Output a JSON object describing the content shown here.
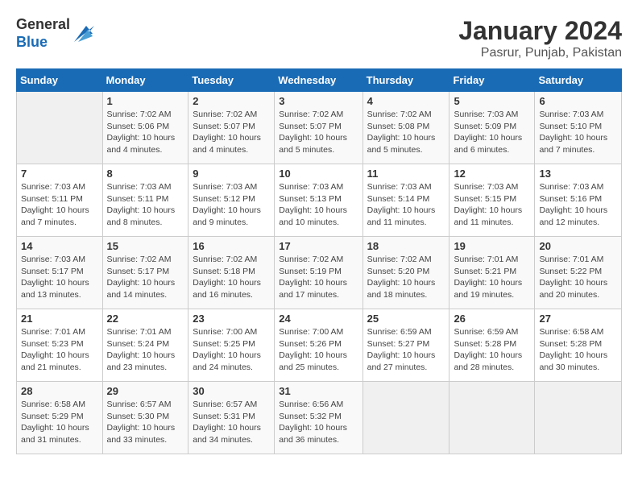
{
  "header": {
    "logo_line1": "General",
    "logo_line2": "Blue",
    "title": "January 2024",
    "subtitle": "Pasrur, Punjab, Pakistan"
  },
  "columns": [
    "Sunday",
    "Monday",
    "Tuesday",
    "Wednesday",
    "Thursday",
    "Friday",
    "Saturday"
  ],
  "weeks": [
    [
      {
        "day": "",
        "info": ""
      },
      {
        "day": "1",
        "info": "Sunrise: 7:02 AM\nSunset: 5:06 PM\nDaylight: 10 hours\nand 4 minutes."
      },
      {
        "day": "2",
        "info": "Sunrise: 7:02 AM\nSunset: 5:07 PM\nDaylight: 10 hours\nand 4 minutes."
      },
      {
        "day": "3",
        "info": "Sunrise: 7:02 AM\nSunset: 5:07 PM\nDaylight: 10 hours\nand 5 minutes."
      },
      {
        "day": "4",
        "info": "Sunrise: 7:02 AM\nSunset: 5:08 PM\nDaylight: 10 hours\nand 5 minutes."
      },
      {
        "day": "5",
        "info": "Sunrise: 7:03 AM\nSunset: 5:09 PM\nDaylight: 10 hours\nand 6 minutes."
      },
      {
        "day": "6",
        "info": "Sunrise: 7:03 AM\nSunset: 5:10 PM\nDaylight: 10 hours\nand 7 minutes."
      }
    ],
    [
      {
        "day": "7",
        "info": "Sunrise: 7:03 AM\nSunset: 5:11 PM\nDaylight: 10 hours\nand 7 minutes."
      },
      {
        "day": "8",
        "info": "Sunrise: 7:03 AM\nSunset: 5:11 PM\nDaylight: 10 hours\nand 8 minutes."
      },
      {
        "day": "9",
        "info": "Sunrise: 7:03 AM\nSunset: 5:12 PM\nDaylight: 10 hours\nand 9 minutes."
      },
      {
        "day": "10",
        "info": "Sunrise: 7:03 AM\nSunset: 5:13 PM\nDaylight: 10 hours\nand 10 minutes."
      },
      {
        "day": "11",
        "info": "Sunrise: 7:03 AM\nSunset: 5:14 PM\nDaylight: 10 hours\nand 11 minutes."
      },
      {
        "day": "12",
        "info": "Sunrise: 7:03 AM\nSunset: 5:15 PM\nDaylight: 10 hours\nand 11 minutes."
      },
      {
        "day": "13",
        "info": "Sunrise: 7:03 AM\nSunset: 5:16 PM\nDaylight: 10 hours\nand 12 minutes."
      }
    ],
    [
      {
        "day": "14",
        "info": "Sunrise: 7:03 AM\nSunset: 5:17 PM\nDaylight: 10 hours\nand 13 minutes."
      },
      {
        "day": "15",
        "info": "Sunrise: 7:02 AM\nSunset: 5:17 PM\nDaylight: 10 hours\nand 14 minutes."
      },
      {
        "day": "16",
        "info": "Sunrise: 7:02 AM\nSunset: 5:18 PM\nDaylight: 10 hours\nand 16 minutes."
      },
      {
        "day": "17",
        "info": "Sunrise: 7:02 AM\nSunset: 5:19 PM\nDaylight: 10 hours\nand 17 minutes."
      },
      {
        "day": "18",
        "info": "Sunrise: 7:02 AM\nSunset: 5:20 PM\nDaylight: 10 hours\nand 18 minutes."
      },
      {
        "day": "19",
        "info": "Sunrise: 7:01 AM\nSunset: 5:21 PM\nDaylight: 10 hours\nand 19 minutes."
      },
      {
        "day": "20",
        "info": "Sunrise: 7:01 AM\nSunset: 5:22 PM\nDaylight: 10 hours\nand 20 minutes."
      }
    ],
    [
      {
        "day": "21",
        "info": "Sunrise: 7:01 AM\nSunset: 5:23 PM\nDaylight: 10 hours\nand 21 minutes."
      },
      {
        "day": "22",
        "info": "Sunrise: 7:01 AM\nSunset: 5:24 PM\nDaylight: 10 hours\nand 23 minutes."
      },
      {
        "day": "23",
        "info": "Sunrise: 7:00 AM\nSunset: 5:25 PM\nDaylight: 10 hours\nand 24 minutes."
      },
      {
        "day": "24",
        "info": "Sunrise: 7:00 AM\nSunset: 5:26 PM\nDaylight: 10 hours\nand 25 minutes."
      },
      {
        "day": "25",
        "info": "Sunrise: 6:59 AM\nSunset: 5:27 PM\nDaylight: 10 hours\nand 27 minutes."
      },
      {
        "day": "26",
        "info": "Sunrise: 6:59 AM\nSunset: 5:28 PM\nDaylight: 10 hours\nand 28 minutes."
      },
      {
        "day": "27",
        "info": "Sunrise: 6:58 AM\nSunset: 5:28 PM\nDaylight: 10 hours\nand 30 minutes."
      }
    ],
    [
      {
        "day": "28",
        "info": "Sunrise: 6:58 AM\nSunset: 5:29 PM\nDaylight: 10 hours\nand 31 minutes."
      },
      {
        "day": "29",
        "info": "Sunrise: 6:57 AM\nSunset: 5:30 PM\nDaylight: 10 hours\nand 33 minutes."
      },
      {
        "day": "30",
        "info": "Sunrise: 6:57 AM\nSunset: 5:31 PM\nDaylight: 10 hours\nand 34 minutes."
      },
      {
        "day": "31",
        "info": "Sunrise: 6:56 AM\nSunset: 5:32 PM\nDaylight: 10 hours\nand 36 minutes."
      },
      {
        "day": "",
        "info": ""
      },
      {
        "day": "",
        "info": ""
      },
      {
        "day": "",
        "info": ""
      }
    ]
  ]
}
